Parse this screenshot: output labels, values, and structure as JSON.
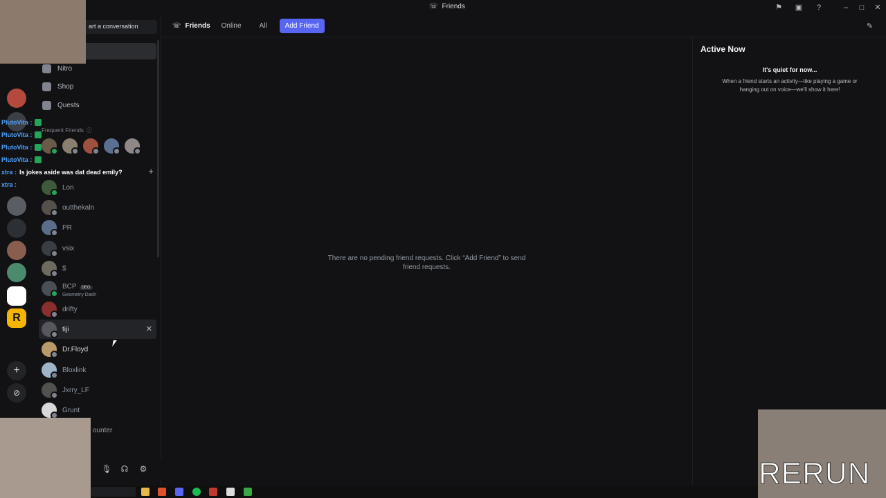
{
  "window": {
    "title": "Friends"
  },
  "titlebar_icons": [
    "flag-icon",
    "inbox-icon",
    "help-icon",
    "minimize-icon",
    "maximize-icon",
    "close-icon"
  ],
  "sidebar": {
    "search_label": "art a conversation",
    "nav": [
      {
        "label": "Nitro",
        "icon": "nitro-icon"
      },
      {
        "label": "Shop",
        "icon": "shop-icon"
      },
      {
        "label": "Quests",
        "icon": "quests-icon"
      }
    ],
    "frequent_label": "Frequent Friends",
    "dm_header": "",
    "dms": [
      {
        "name": "Lon",
        "online": true
      },
      {
        "name": "outthekaln",
        "online": false
      },
      {
        "name": "PR",
        "online": false
      },
      {
        "name": "vsix",
        "online": false
      },
      {
        "name": "$",
        "online": false
      },
      {
        "name": "BCP",
        "badge": "DEO",
        "sub": "Geometry Dash",
        "online": true
      },
      {
        "name": "drifty",
        "online": false
      },
      {
        "name": "tiji",
        "online": false,
        "active": true
      },
      {
        "name": "Dr.Floyd",
        "online": false
      },
      {
        "name": "Bloxlink",
        "online": false
      },
      {
        "name": "Jxrry_LF",
        "online": false
      },
      {
        "name": "Grunt",
        "online": false
      },
      {
        "name": "ounter",
        "online": false
      }
    ]
  },
  "header": {
    "friends_label": "Friends",
    "tabs": [
      "Online",
      "All"
    ],
    "add_friend": "Add Friend"
  },
  "main": {
    "empty_line1": "There are no pending friend requests. Click “Add Friend” to send",
    "empty_line2": "friend requests."
  },
  "active_now": {
    "title": "Active Now",
    "quiet": "It's quiet for now...",
    "desc_line1": "When a friend starts an activity—like playing a game or",
    "desc_line2": "hanging out on voice—we'll show it here!"
  },
  "overlay": {
    "chat": [
      {
        "user": "PlutoVita :",
        "msg": ""
      },
      {
        "user": "PlutoVita :",
        "msg": ""
      },
      {
        "user": "PlutoVita :",
        "msg": ""
      },
      {
        "user": "PlutoVita :",
        "msg": ""
      },
      {
        "user": "xtra :",
        "msg": "Is jokes aside was dat dead emily?"
      },
      {
        "user": "xtra :",
        "msg": ""
      }
    ],
    "watermark": "RERUN"
  },
  "colors": {
    "accent": "#5865f2",
    "online": "#23a55a",
    "bg": "#121214"
  }
}
